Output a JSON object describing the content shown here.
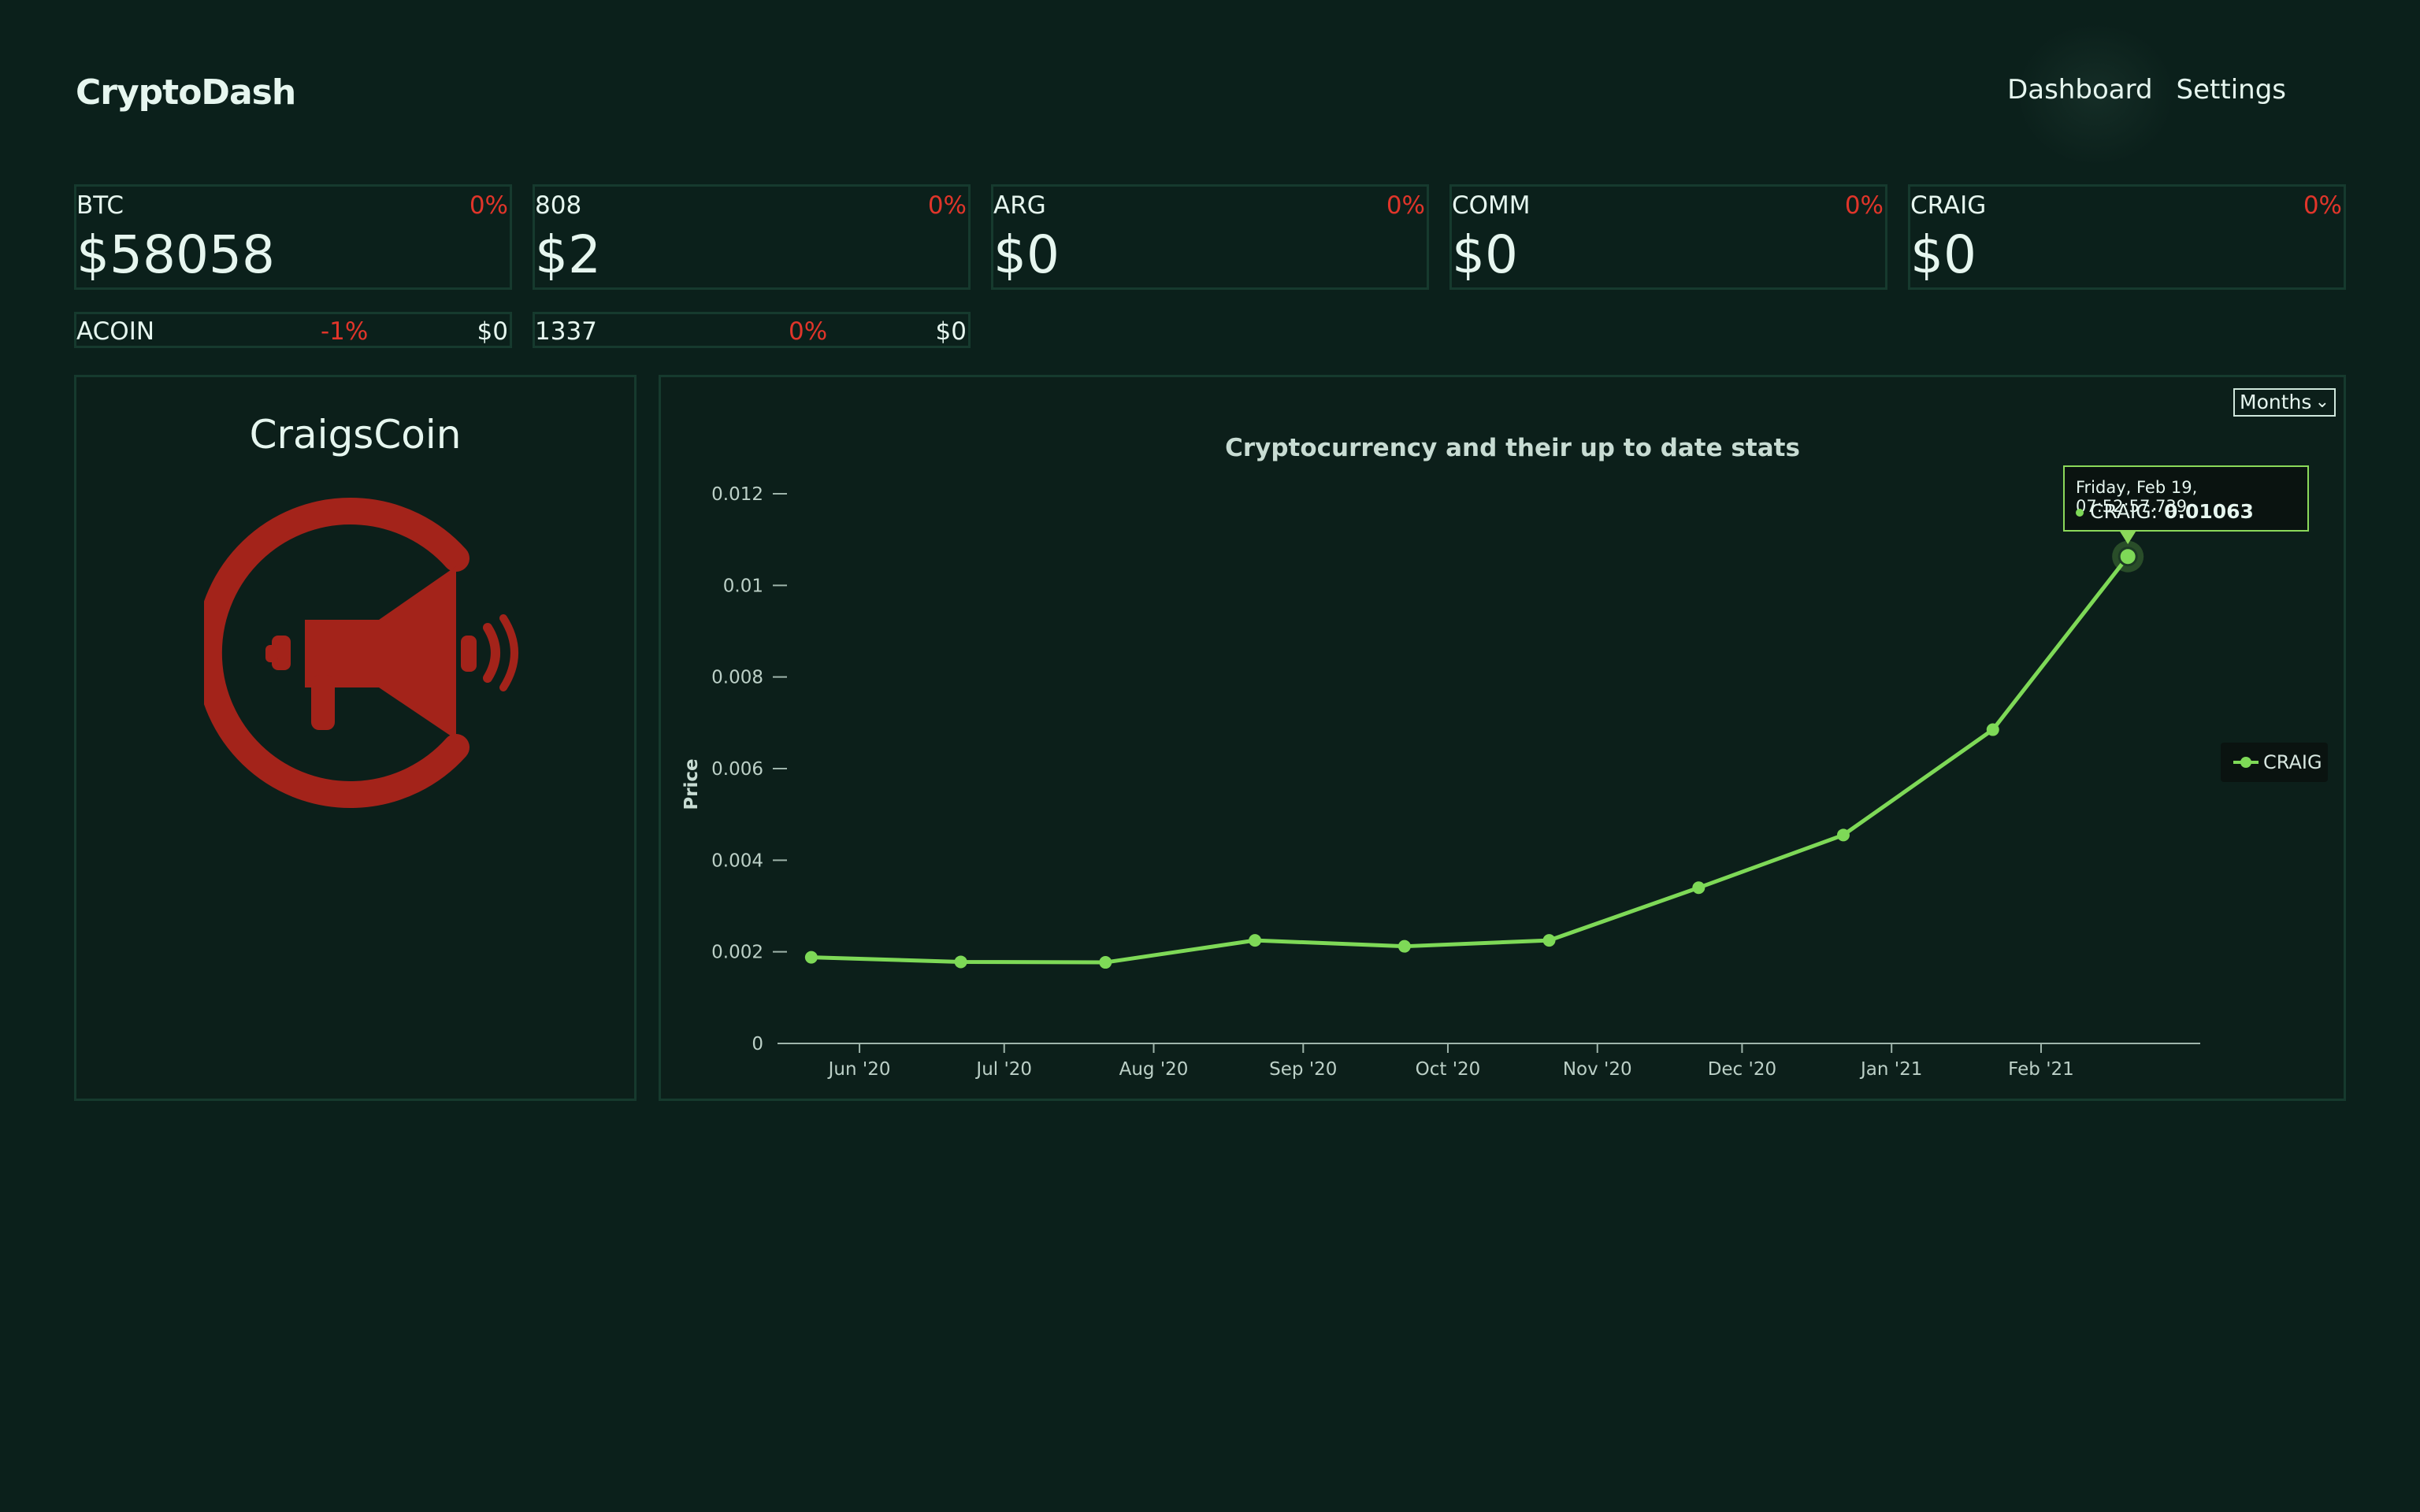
{
  "header": {
    "brand": "CryptoDash",
    "nav": [
      "Dashboard",
      "Settings"
    ]
  },
  "tickers_big": [
    {
      "symbol": "BTC",
      "change": "0%",
      "price": "$58058"
    },
    {
      "symbol": "808",
      "change": "0%",
      "price": "$2"
    },
    {
      "symbol": "ARG",
      "change": "0%",
      "price": "$0"
    },
    {
      "symbol": "COMM",
      "change": "0%",
      "price": "$0"
    },
    {
      "symbol": "CRAIG",
      "change": "0%",
      "price": "$0"
    }
  ],
  "tickers_small": [
    {
      "symbol": "ACOIN",
      "change": "-1%",
      "price": "$0"
    },
    {
      "symbol": "1337",
      "change": "0%",
      "price": "$0"
    }
  ],
  "coin_panel": {
    "title": "CraigsCoin",
    "logo_icon": "megaphone-logo"
  },
  "colors": {
    "accent": "#7ed957",
    "negative": "#e0352a",
    "background": "#0b201b",
    "logo": "#a3231a"
  },
  "chart_panel": {
    "range_selected": "Months",
    "tooltip": {
      "date": "Friday, Feb 19, 07:52:57.739",
      "series": "CRAIG",
      "value": "0.01063"
    }
  },
  "chart_data": {
    "type": "line",
    "title": "Cryptocurrency and their up to date stats",
    "ylabel": "Price",
    "xlabel": "",
    "ylim": [
      0,
      0.012
    ],
    "yticks": [
      "0",
      "0.002",
      "0.004",
      "0.006",
      "0.008",
      "0.01",
      "0.012"
    ],
    "xticks": [
      "Jun '20",
      "Jul '20",
      "Aug '20",
      "Sep '20",
      "Oct '20",
      "Nov '20",
      "Dec '20",
      "Jan '21",
      "Feb '21"
    ],
    "legend": "right",
    "series": [
      {
        "name": "CRAIG",
        "x": [
          "2020-05-22",
          "2020-06-22",
          "2020-07-22",
          "2020-08-22",
          "2020-09-22",
          "2020-10-22",
          "2020-11-22",
          "2020-12-22",
          "2021-01-22",
          "2021-02-19"
        ],
        "values": [
          0.00188,
          0.00178,
          0.00177,
          0.00225,
          0.00212,
          0.00225,
          0.0034,
          0.00455,
          0.00685,
          0.01063
        ]
      }
    ]
  }
}
